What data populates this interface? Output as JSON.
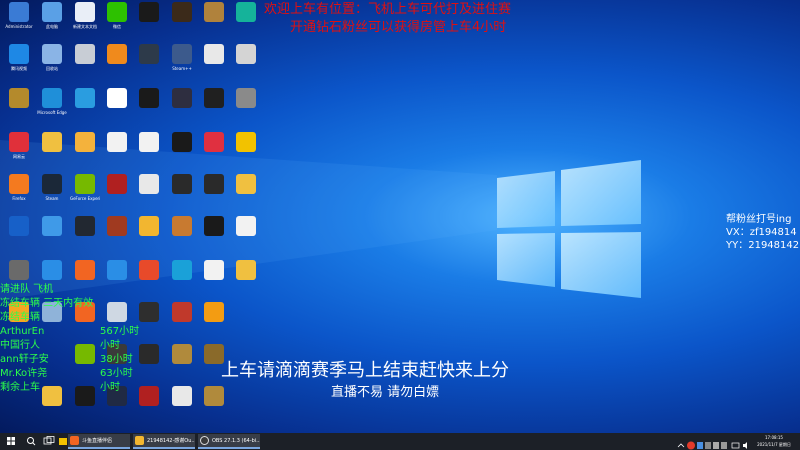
{
  "desktop": {
    "icons": [
      {
        "label": "Administrator",
        "color": "#3a7bd5"
      },
      {
        "label": "此电脑",
        "color": "#5aa0e6"
      },
      {
        "label": "新建文本文档",
        "color": "#e9eef7"
      },
      {
        "label": "微信",
        "color": "#2dc100"
      },
      {
        "label": "",
        "color": "#1a1a1a"
      },
      {
        "label": "",
        "color": "#3b2a1a"
      },
      {
        "label": "",
        "color": "#b0823c"
      },
      {
        "label": "",
        "color": "#15b39a"
      },
      {
        "label": "腾讯视频",
        "color": "#1e88e5"
      },
      {
        "label": "回收站",
        "color": "#8ab4e6"
      },
      {
        "label": "",
        "color": "#c8cdd5"
      },
      {
        "label": "",
        "color": "#f08a1c"
      },
      {
        "label": "",
        "color": "#2d3a4a"
      },
      {
        "label": "Steam++",
        "color": "#3c5a8c"
      },
      {
        "label": "",
        "color": "#e8e8e8"
      },
      {
        "label": "",
        "color": "#d4d4d4"
      },
      {
        "label": "",
        "color": "#b48a2c"
      },
      {
        "label": "Microsoft Edge",
        "color": "#1f8fd9"
      },
      {
        "label": "",
        "color": "#2a9de0"
      },
      {
        "label": "",
        "color": "#ffffff"
      },
      {
        "label": "",
        "color": "#1a1a1a"
      },
      {
        "label": "",
        "color": "#2e2e40"
      },
      {
        "label": "",
        "color": "#202020"
      },
      {
        "label": "",
        "color": "#8a8a8a"
      },
      {
        "label": "网易云",
        "color": "#e0303a"
      },
      {
        "label": "",
        "color": "#f0c040"
      },
      {
        "label": "",
        "color": "#f4b23c"
      },
      {
        "label": "",
        "color": "#f2f2f2"
      },
      {
        "label": "",
        "color": "#f2f2f2"
      },
      {
        "label": "",
        "color": "#1a1a1a"
      },
      {
        "label": "",
        "color": "#e03040"
      },
      {
        "label": "",
        "color": "#f2c200"
      },
      {
        "label": "Firefox",
        "color": "#f47a1f"
      },
      {
        "label": "Steam",
        "color": "#1b2838"
      },
      {
        "label": "GeForce Experience",
        "color": "#76b900"
      },
      {
        "label": "",
        "color": "#b02020"
      },
      {
        "label": "",
        "color": "#e8e8e8"
      },
      {
        "label": "",
        "color": "#2a2a2a"
      },
      {
        "label": "",
        "color": "#2a2a2a"
      },
      {
        "label": "",
        "color": "#f0c040"
      },
      {
        "label": "",
        "color": "#1760c8"
      },
      {
        "label": "",
        "color": "#3f9ae8"
      },
      {
        "label": "",
        "color": "#222831"
      },
      {
        "label": "",
        "color": "#a03a20"
      },
      {
        "label": "",
        "color": "#f2b630"
      },
      {
        "label": "",
        "color": "#c87a30"
      },
      {
        "label": "",
        "color": "#1a1a1a"
      },
      {
        "label": "",
        "color": "#f2f2f2"
      },
      {
        "label": "",
        "color": "#6a6a6a"
      },
      {
        "label": "",
        "color": "#2a8ee6"
      },
      {
        "label": "",
        "color": "#f26522"
      },
      {
        "label": "",
        "color": "#2a8ee6"
      },
      {
        "label": "",
        "color": "#e84a2a"
      },
      {
        "label": "",
        "color": "#1aa1d8"
      },
      {
        "label": "",
        "color": "#f2f2f2"
      },
      {
        "label": "",
        "color": "#f0c040"
      },
      {
        "label": "",
        "color": "#f5a623"
      },
      {
        "label": "",
        "color": "#8fb3d9"
      },
      {
        "label": "",
        "color": "#f26522"
      },
      {
        "label": "",
        "color": "#cfd8e3"
      },
      {
        "label": "",
        "color": "#2e2e2e"
      },
      {
        "label": "",
        "color": "#c0392b"
      },
      {
        "label": "",
        "color": "#f39c12"
      },
      {
        "label": "",
        "color": ""
      },
      {
        "label": "",
        "color": ""
      },
      {
        "label": "",
        "color": ""
      },
      {
        "label": "",
        "color": "#76b900"
      },
      {
        "label": "",
        "color": "#3a3a3a"
      },
      {
        "label": "",
        "color": "#2a2a2a"
      },
      {
        "label": "",
        "color": "#b08a3c"
      },
      {
        "label": "",
        "color": "#8a6a2a"
      },
      {
        "label": "",
        "color": ""
      },
      {
        "label": "",
        "color": ""
      },
      {
        "label": "",
        "color": "#f0c040"
      },
      {
        "label": "",
        "color": "#1a1a1a"
      },
      {
        "label": "",
        "color": "#202a44"
      },
      {
        "label": "",
        "color": "#b02020"
      },
      {
        "label": "",
        "color": "#e8e8e8"
      },
      {
        "label": "",
        "color": "#b08a3c"
      },
      {
        "label": ""
      }
    ]
  },
  "overlay": {
    "line1": "欢迎上车有位置：飞机上车可代打及进住赛",
    "line2": "开通钻石粉丝可以获得房管上车4小时",
    "green_rows": [
      {
        "name": "请进队 飞机",
        "amount": ""
      },
      {
        "name": "冻结车辆 三天内有效",
        "amount": ""
      },
      {
        "name": "冻结车辆",
        "amount": ""
      },
      {
        "name": "ArthurEn",
        "amount": "567小时"
      },
      {
        "name": "中国行人",
        "amount": "小时"
      },
      {
        "name": "ann轩子安",
        "amount": "38小时"
      },
      {
        "name": "Mr.Ko许尧",
        "amount": "63小时"
      },
      {
        "name": "剩余上车",
        "amount": "小时"
      }
    ],
    "right_title": "帮粉丝打号ing",
    "right_vx": "VX：zf194814",
    "right_yy": "YY：21948142",
    "banner": "上车请滴滴赛季马上结束赶快来上分",
    "banner_sub": "直播不易 请勿白嫖"
  },
  "taskbar": {
    "apps": [
      {
        "label": "斗鱼直播伴侣",
        "color": "#f26522"
      },
      {
        "label": "21948142-感谢Ou...",
        "color": "#f2b630"
      },
      {
        "label": "OBS 27.1.3 (64-bi...",
        "color": "#3a3a3a"
      }
    ],
    "clock_time": "17:08:15",
    "clock_date": "2021/11/7 星期日"
  },
  "colors": {
    "accent_red": "#e01010",
    "accent_green": "#2bff4a",
    "taskbar": "#1c2027"
  }
}
